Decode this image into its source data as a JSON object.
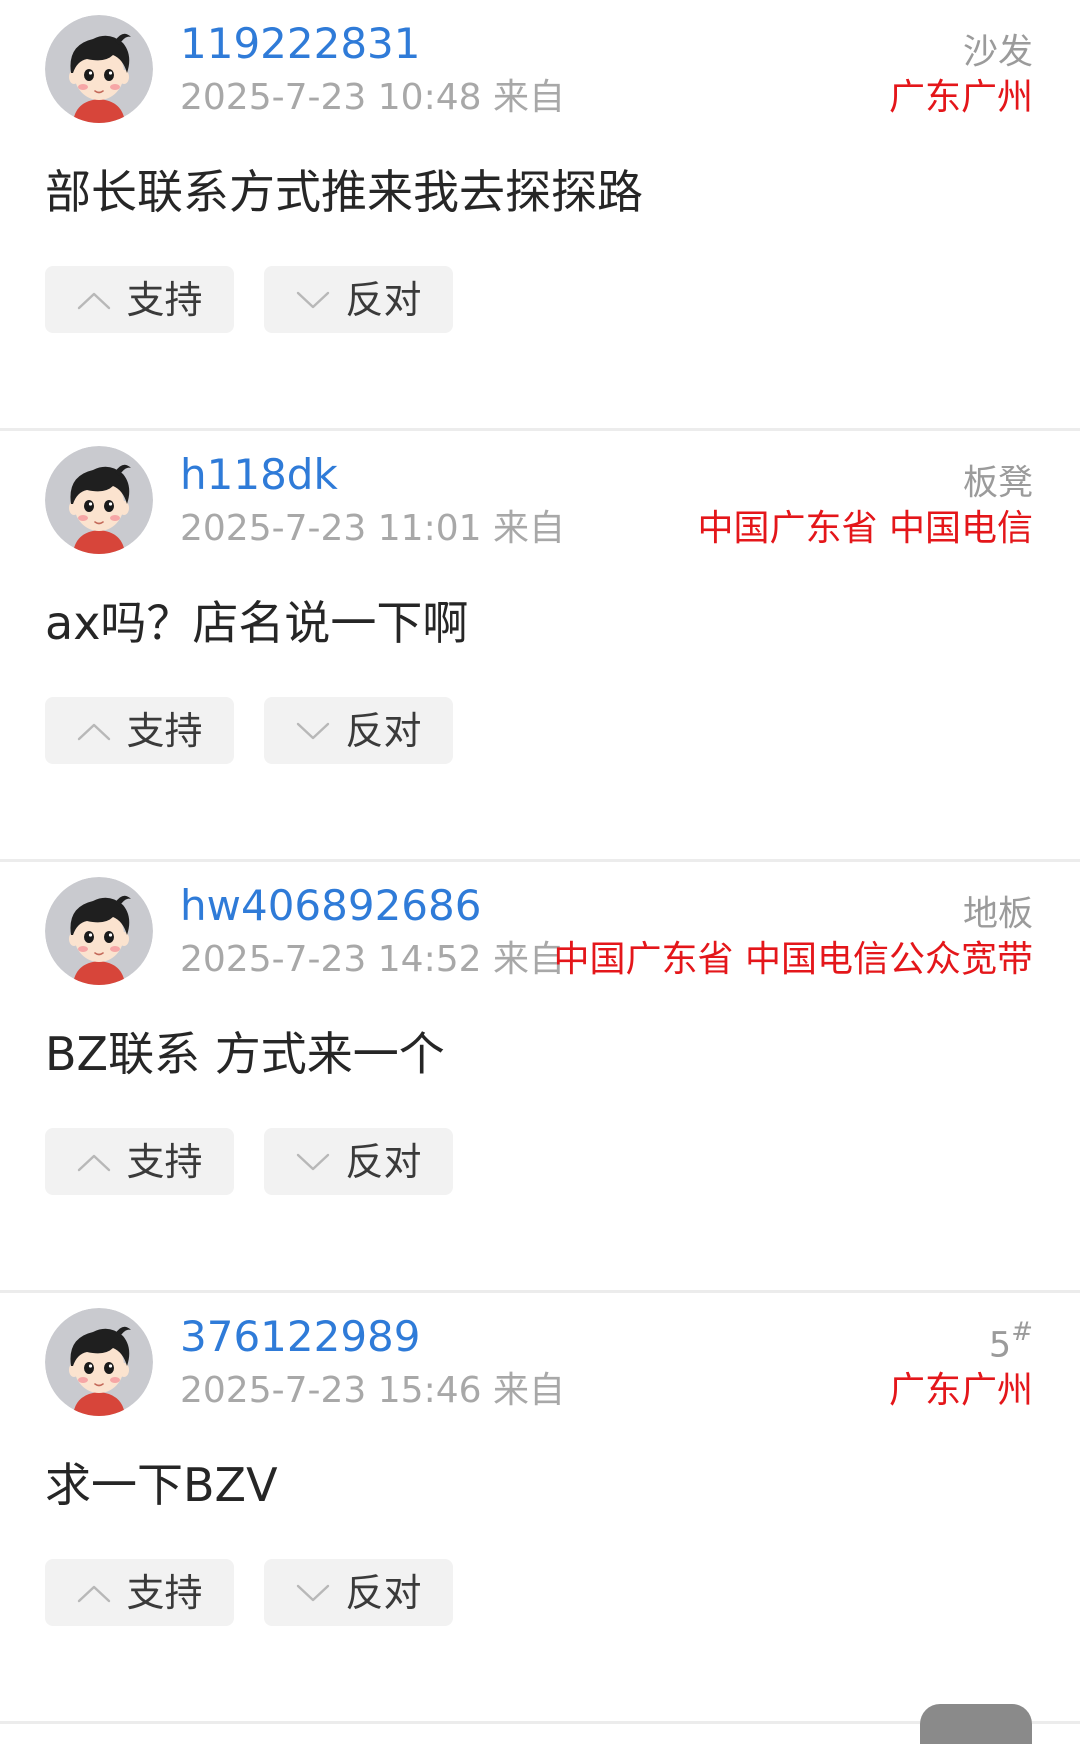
{
  "comments": [
    {
      "username": "119222831",
      "meta": "2025-7-23 10:48 来自",
      "floor": "沙发",
      "floor_sup": "",
      "location": "广东广州",
      "content": "部长联系方式推来我去探探路",
      "upvote_label": "支持",
      "downvote_label": "反对"
    },
    {
      "username": "h118dk",
      "meta": "2025-7-23 11:01 来自",
      "floor": "板凳",
      "floor_sup": "",
      "location": "中国广东省 中国电信",
      "content": "ax吗？店名说一下啊",
      "upvote_label": "支持",
      "downvote_label": "反对"
    },
    {
      "username": "hw406892686",
      "meta": "2025-7-23 14:52 来自",
      "floor": "地板",
      "floor_sup": "",
      "location": "中国广东省 中国电信公众宽带",
      "content": "BZ联系 方式来一个",
      "upvote_label": "支持",
      "downvote_label": "反对"
    },
    {
      "username": "376122989",
      "meta": "2025-7-23 15:46 来自",
      "floor": "5",
      "floor_sup": "#",
      "location": "广东广州",
      "content": "求一下BZV",
      "upvote_label": "支持",
      "downvote_label": "反对"
    }
  ],
  "icons": {
    "upvote": "chevron-up-icon",
    "downvote": "chevron-down-icon",
    "avatar": "default-user-avatar"
  },
  "colors": {
    "username": "#2f7bd8",
    "location": "#e4161a",
    "meta": "#a8a8a8"
  }
}
